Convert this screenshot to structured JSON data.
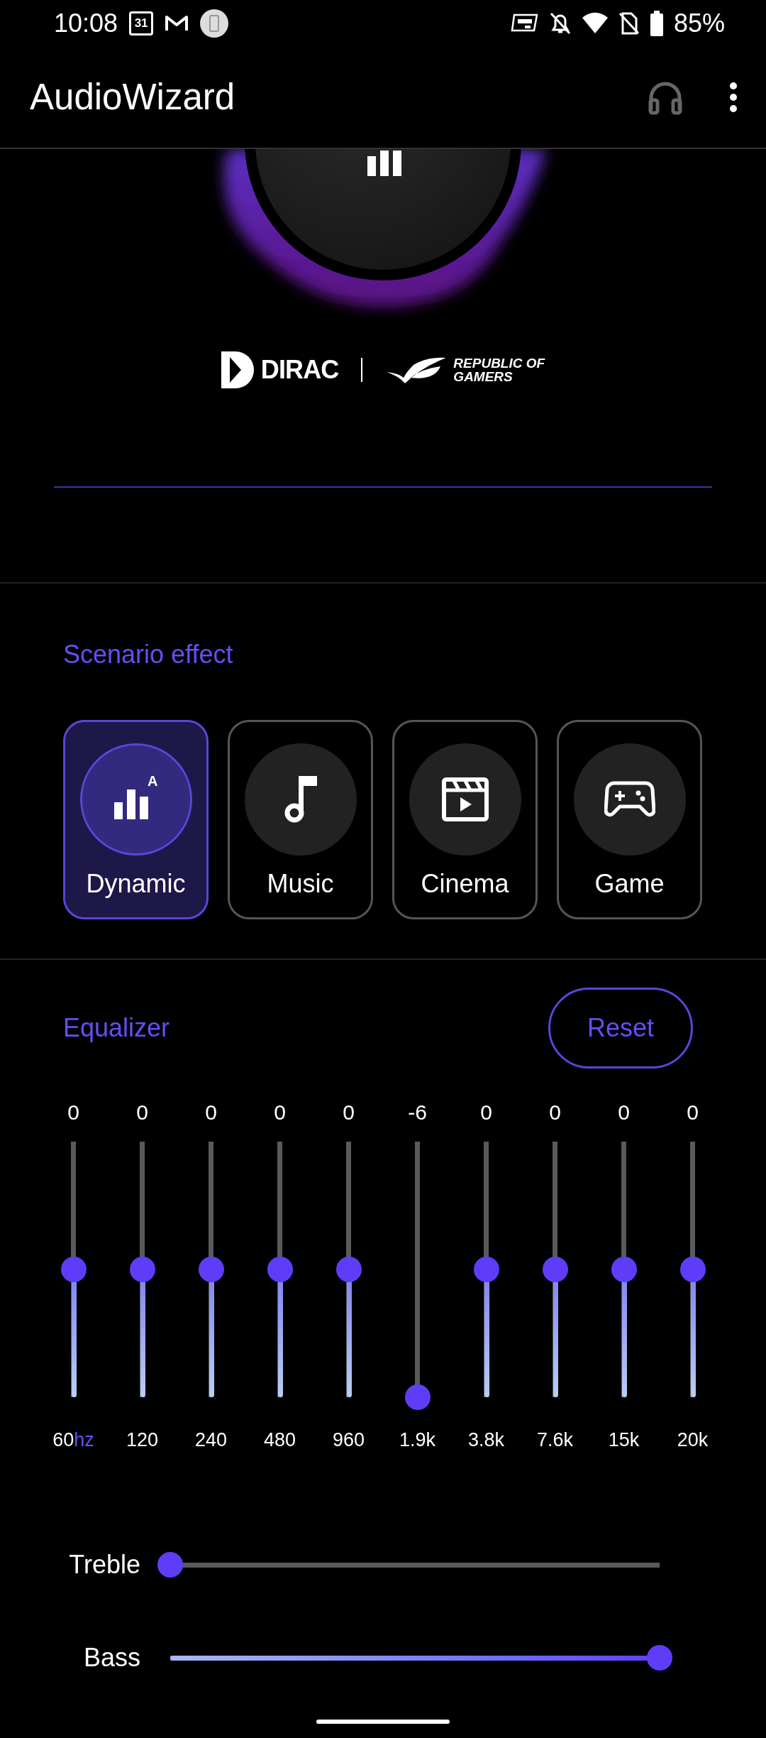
{
  "status_bar": {
    "time": "10:08",
    "calendar_day": "31",
    "battery": "85%"
  },
  "app_bar": {
    "title": "AudioWizard"
  },
  "brands": {
    "dirac": "DIRAC",
    "rog_line_1": "REPUBLIC OF",
    "rog_line_2": "GAMERS"
  },
  "scenario": {
    "title": "Scenario effect",
    "items": [
      {
        "kind": "dynamic",
        "label": "Dynamic",
        "badge": "A",
        "selected": true
      },
      {
        "kind": "music",
        "label": "Music",
        "selected": false
      },
      {
        "kind": "cinema",
        "label": "Cinema",
        "selected": false
      },
      {
        "kind": "game",
        "label": "Game",
        "selected": false
      }
    ]
  },
  "equalizer": {
    "title": "Equalizer",
    "reset": "Reset",
    "bands": [
      {
        "value": "0",
        "label": "60",
        "unit": "hz",
        "level": 0.5
      },
      {
        "value": "0",
        "label": "120",
        "level": 0.5
      },
      {
        "value": "0",
        "label": "240",
        "level": 0.5
      },
      {
        "value": "0",
        "label": "480",
        "level": 0.5
      },
      {
        "value": "0",
        "label": "960",
        "level": 0.5
      },
      {
        "value": "-6",
        "label": "1.9k",
        "level": 0
      },
      {
        "value": "0",
        "label": "3.8k",
        "level": 0.5
      },
      {
        "value": "0",
        "label": "7.6k",
        "level": 0.5
      },
      {
        "value": "0",
        "label": "15k",
        "level": 0.5
      },
      {
        "value": "0",
        "label": "20k",
        "level": 0.5
      }
    ]
  },
  "tone": [
    {
      "label": "Treble",
      "level": 0
    },
    {
      "label": "Bass",
      "level": 1
    }
  ]
}
